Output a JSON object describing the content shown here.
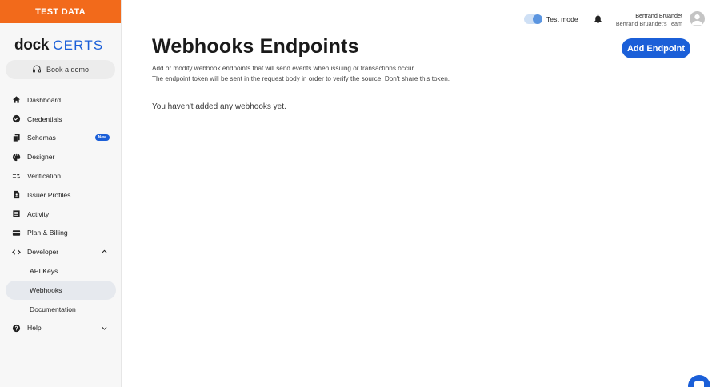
{
  "banner": {
    "label": "TEST DATA"
  },
  "logo": {
    "word1": "dock",
    "word2": "CERTS"
  },
  "demo": {
    "label": "Book a demo",
    "icon": "headset-icon"
  },
  "nav": {
    "items": [
      {
        "label": "Dashboard",
        "icon": "home-icon"
      },
      {
        "label": "Credentials",
        "icon": "verified-badge-icon"
      },
      {
        "label": "Schemas",
        "icon": "copy-icon",
        "badge": "New"
      },
      {
        "label": "Designer",
        "icon": "palette-icon"
      },
      {
        "label": "Verification",
        "icon": "checklist-icon"
      },
      {
        "label": "Issuer Profiles",
        "icon": "file-user-icon"
      },
      {
        "label": "Activity",
        "icon": "list-icon"
      },
      {
        "label": "Plan & Billing",
        "icon": "credit-card-icon"
      },
      {
        "label": "Developer",
        "icon": "code-icon"
      }
    ],
    "developer_sub": [
      {
        "label": "API Keys"
      },
      {
        "label": "Webhooks",
        "active": true
      },
      {
        "label": "Documentation"
      }
    ],
    "help": {
      "label": "Help",
      "icon": "help-icon"
    }
  },
  "topbar": {
    "test_mode_label": "Test mode",
    "test_mode_on": true,
    "user_name": "Bertrand Bruandet",
    "user_team": "Bertrand Bruandet's Team"
  },
  "main": {
    "title": "Webhooks Endpoints",
    "desc_line1": "Add or modify webhook endpoints that will send events when issuing or transactions occur.",
    "desc_line2": "The endpoint token will be sent in the request body in order to verify the source. Don't share this token.",
    "empty_message": "You haven't added any webhooks yet.",
    "add_button": "Add Endpoint"
  },
  "colors": {
    "accent": "#1b5fd8",
    "banner": "#f26a1b"
  }
}
